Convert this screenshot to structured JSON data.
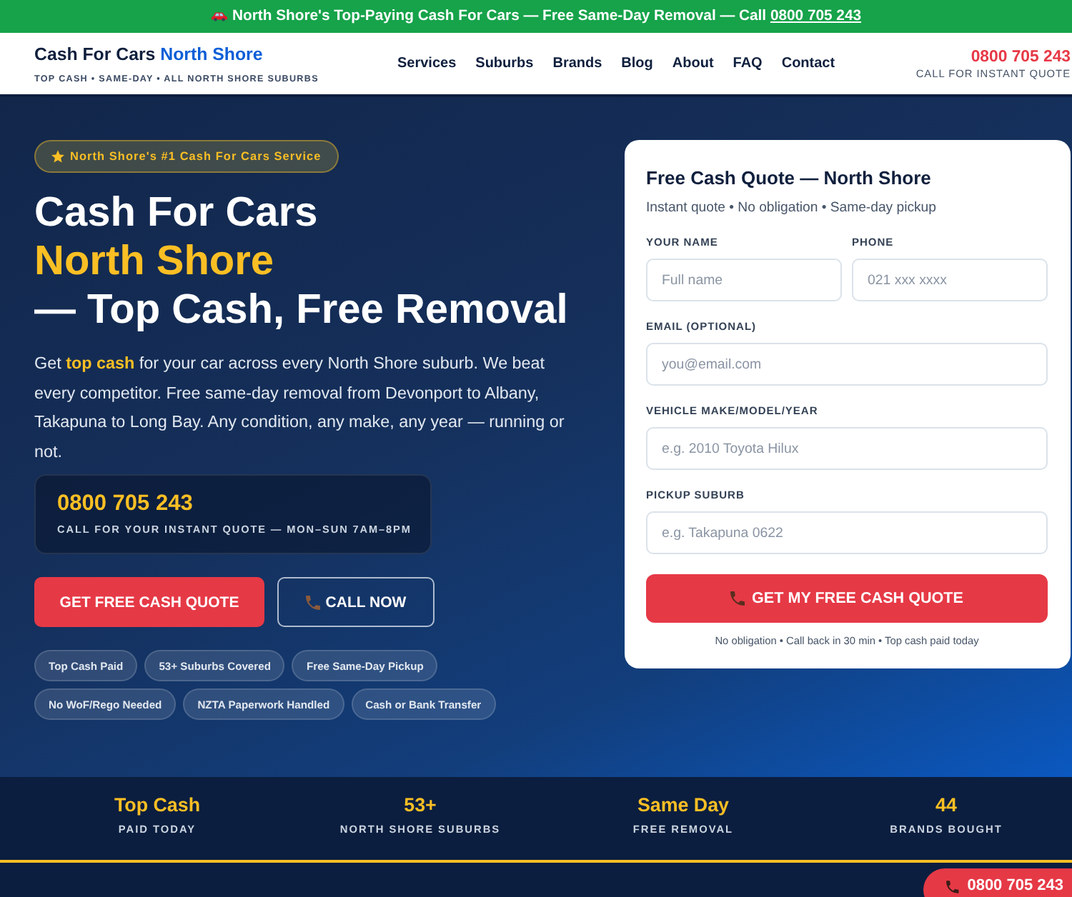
{
  "announcement_bar": {
    "text": "North Shore's Top-Paying Cash For Cars — Free Same-Day Removal — Call",
    "phone_link": "0800 705 243"
  },
  "header": {
    "logo": {
      "text": "Cash For Cars",
      "accent": "North Shore"
    },
    "tagline": "TOP CASH • SAME-DAY • ALL NORTH SHORE SUBURBS",
    "nav": [
      "Services",
      "Suburbs",
      "Brands",
      "Blog",
      "About",
      "FAQ",
      "Contact"
    ],
    "phone": "0800 705 243",
    "phone_caption": "CALL FOR INSTANT QUOTE"
  },
  "hero": {
    "badge": "North Shore's #1 Cash For Cars Service",
    "title": {
      "lead": "Cash For Cars",
      "accent": "North Shore",
      "tail": "— Top Cash, Free Removal"
    },
    "intro": "Get **top cash** for your car across every North Shore suburb. We beat every competitor. Free same-day removal from Devonport to Albany, Takapuna to Long Bay. Any condition, any make, any year — running or not.",
    "phone_box": {
      "number": "0800 705 243",
      "caption": "CALL FOR YOUR INSTANT QUOTE — MON–SUN 7AM–8PM"
    },
    "buttons": [
      {
        "label": "GET FREE CASH QUOTE",
        "kind": "primary"
      },
      {
        "label": "CALL NOW",
        "kind": "call"
      }
    ],
    "chips": [
      "Top Cash Paid",
      "53+ Suburbs Covered",
      "Free Same-Day Pickup",
      "No WoF/Rego Needed",
      "NZTA Paperwork Handled",
      "Cash or Bank Transfer"
    ]
  },
  "quote_form": {
    "title": "Free Cash Quote — North Shore",
    "subtitle": "Instant quote • No obligation • Same-day pickup",
    "field_rows": [
      [
        {
          "label": "YOUR NAME",
          "placeholder": "Full name"
        },
        {
          "label": "PHONE",
          "placeholder": "021 xxx xxxx"
        }
      ],
      [
        {
          "label": "EMAIL (OPTIONAL)",
          "placeholder": "you@email.com"
        }
      ],
      [
        {
          "label": "VEHICLE MAKE/MODEL/YEAR",
          "placeholder": "e.g. 2010 Toyota Hilux"
        }
      ],
      [
        {
          "label": "PICKUP SUBURB",
          "placeholder": "e.g. Takapuna 0622"
        }
      ]
    ],
    "submit": "GET MY FREE CASH QUOTE",
    "footnote": "No obligation • Call back in 30 min • Top cash paid today"
  },
  "stats": [
    {
      "value": "Top Cash",
      "label": "PAID TODAY"
    },
    {
      "value": "53+",
      "label": "NORTH SHORE SUBURBS"
    },
    {
      "value": "Same Day",
      "label": "FREE REMOVAL"
    },
    {
      "value": "44",
      "label": "BRANDS BOUGHT"
    }
  ],
  "floating_call": {
    "label": "0800 705 243"
  }
}
